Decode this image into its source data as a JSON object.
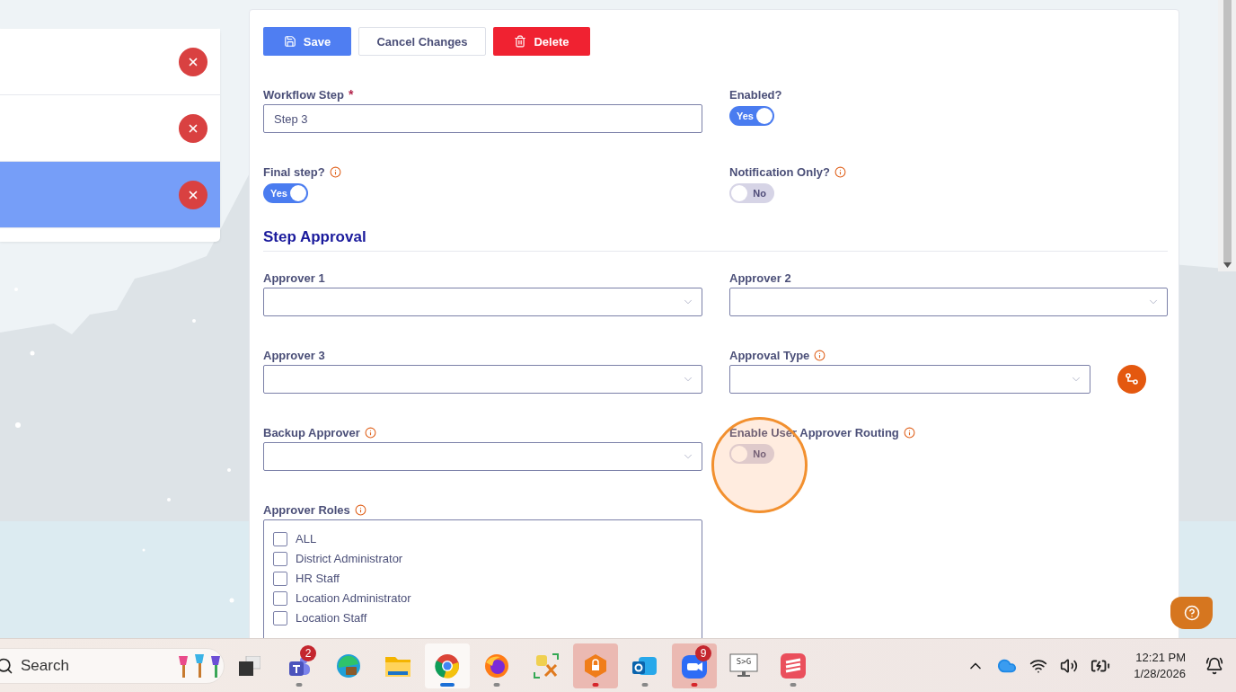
{
  "step_list": [
    {
      "selected": false
    },
    {
      "selected": false
    },
    {
      "selected": true
    }
  ],
  "toolbar": {
    "save": "Save",
    "cancel": "Cancel Changes",
    "delete": "Delete"
  },
  "general_fields": [
    {
      "kind": "text",
      "label": "Workflow Step",
      "required_mark": "*",
      "value": "Step 3"
    },
    {
      "kind": "toggle",
      "label": "Enabled?",
      "on": true,
      "text": "Yes"
    },
    {
      "kind": "toggle",
      "label": "Final step?",
      "info": true,
      "on": true,
      "text": "Yes"
    },
    {
      "kind": "toggle",
      "label": "Notification Only?",
      "info": true,
      "on": false,
      "text": "No"
    }
  ],
  "section_title": "Step Approval",
  "approval_fields": [
    {
      "kind": "select",
      "label": "Approver 1"
    },
    {
      "kind": "select",
      "label": "Approver 2"
    },
    {
      "kind": "select",
      "label": "Approver 3"
    },
    {
      "kind": "select",
      "label": "Approval Type",
      "info": true,
      "action_button": true
    },
    {
      "kind": "select",
      "label": "Backup Approver",
      "info": true
    },
    {
      "kind": "toggle",
      "label": "Enable User Approver Routing",
      "info": true,
      "on": false,
      "text": "No"
    },
    {
      "kind": "checklist",
      "label": "Approver Roles",
      "info": true,
      "options": [
        {
          "label": "ALL",
          "checked": false
        },
        {
          "label": "District Administrator",
          "checked": false
        },
        {
          "label": "HR Staff",
          "checked": false
        },
        {
          "label": "Location Administrator",
          "checked": false
        },
        {
          "label": "Location Staff",
          "checked": false
        }
      ]
    }
  ],
  "taskbar": {
    "search": "Search",
    "apps": [
      {
        "kind": "taskview",
        "running": false,
        "selected": false,
        "attention": false
      },
      {
        "kind": "teams",
        "running": true,
        "selected": false,
        "attention": false,
        "badge": "2"
      },
      {
        "kind": "edge",
        "running": false,
        "selected": false,
        "attention": false
      },
      {
        "kind": "folder",
        "running": false,
        "selected": false,
        "attention": false
      },
      {
        "kind": "chrome",
        "running": true,
        "selected": true,
        "attention": false
      },
      {
        "kind": "firefox",
        "running": true,
        "selected": false,
        "attention": false
      },
      {
        "kind": "tools",
        "running": false,
        "selected": false,
        "attention": false
      },
      {
        "kind": "vpn",
        "running": true,
        "selected": false,
        "attention": true
      },
      {
        "kind": "outlook",
        "running": true,
        "selected": false,
        "attention": false
      },
      {
        "kind": "zoom",
        "running": true,
        "selected": false,
        "attention": true,
        "badge": "9"
      },
      {
        "kind": "monitor",
        "running": false,
        "selected": false,
        "attention": false,
        "text": "S>G"
      },
      {
        "kind": "redapp",
        "running": true,
        "selected": false,
        "attention": false
      }
    ],
    "time": "12:21 PM",
    "date": "1/28/2026"
  }
}
